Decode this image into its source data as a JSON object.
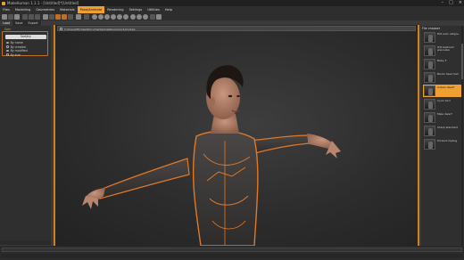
{
  "window": {
    "title": "MakeHuman 1.1.1 - [Untitled]*[Untitled]"
  },
  "menu": [
    "Files",
    "Modelling",
    "Geometries",
    "Materials",
    "Pose/Animate",
    "Rendering",
    "Settings",
    "Utilities",
    "Help"
  ],
  "active_menu": 4,
  "subtabs": [
    "Load",
    "Save",
    "Export"
  ],
  "left_panel": {
    "group_title": "Sort",
    "filter_button": "Sort/by:",
    "options": [
      "By name",
      "By created",
      "By modified",
      "By size"
    ],
    "selected_option": 0
  },
  "viewport": {
    "path": "C:/Users/Michael/Documents/makehuman/v1/models"
  },
  "right_panel": {
    "title": "File chooser",
    "items": [
      "Hilt elvin altigre",
      "Hilt ballroom wannabe",
      "Baby 3",
      "Bardo head ball",
      "Cuban dwarf",
      "Cyrix bird",
      "Male dwarf",
      "Sharp standard",
      "Product lilybug"
    ],
    "selected_index": 4
  },
  "colors": {
    "accent": "#f0a030",
    "suit_trim": "#e07828"
  }
}
